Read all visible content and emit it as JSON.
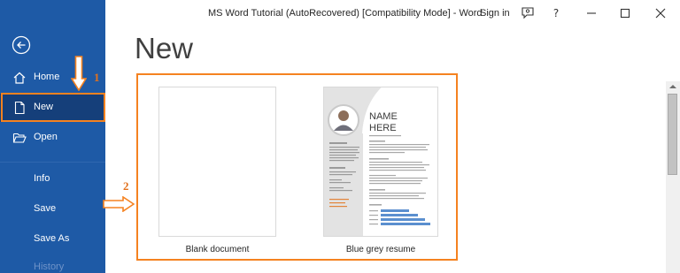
{
  "window": {
    "title": "MS Word Tutorial (AutoRecovered) [Compatibility Mode]  -  Word",
    "sign_in": "Sign in"
  },
  "sidebar": {
    "back_icon": "back-arrow-icon",
    "items": [
      {
        "label": "Home",
        "icon": "home-icon"
      },
      {
        "label": "New",
        "icon": "new-document-icon",
        "selected": true
      },
      {
        "label": "Open",
        "icon": "open-folder-icon"
      },
      {
        "label": "Info"
      },
      {
        "label": "Save"
      },
      {
        "label": "Save As"
      },
      {
        "label": "History"
      }
    ]
  },
  "main": {
    "heading": "New",
    "templates": [
      {
        "label": "Blank document"
      },
      {
        "label": "Blue grey resume",
        "preview": {
          "name_line1": "NAME",
          "name_line2": "HERE"
        }
      }
    ]
  },
  "annotations": {
    "step1": "1",
    "step2": "2",
    "highlight_color": "#f58220"
  },
  "colors": {
    "sidebar_bg": "#1e5aa6",
    "sidebar_selected": "#153f7a",
    "accent_orange": "#f58220"
  }
}
